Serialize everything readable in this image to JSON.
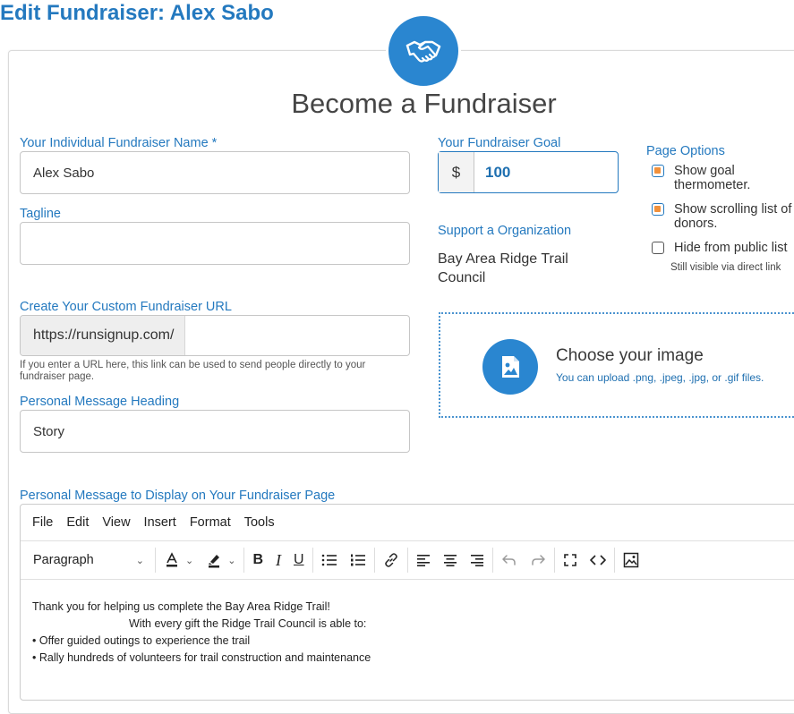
{
  "page": {
    "title": "Edit Fundraiser: Alex Sabo",
    "badge_icon": "handshake-icon"
  },
  "form": {
    "heading": "Become a Fundraiser",
    "name": {
      "label": "Your Individual Fundraiser Name *",
      "value": "Alex Sabo"
    },
    "tagline": {
      "label": "Tagline",
      "value": ""
    },
    "url": {
      "label": "Create Your Custom Fundraiser URL",
      "prefix": "https://runsignup.com/",
      "value": "",
      "help": "If you enter a URL here, this link can be used to send people directly to your fundraiser page."
    },
    "message_heading": {
      "label": "Personal Message Heading",
      "value": "Story"
    },
    "goal": {
      "label": "Your Fundraiser Goal",
      "currency": "$",
      "value": "100"
    },
    "organization": {
      "label": "Support a Organization",
      "name": "Bay Area Ridge Trail Council"
    },
    "page_options": {
      "label": "Page Options",
      "options": [
        {
          "text": "Show goal thermometer.",
          "checked": true
        },
        {
          "text": "Show scrolling list of donors.",
          "checked": true
        },
        {
          "text": "Hide from public list",
          "checked": false
        }
      ],
      "note": "Still visible via direct link"
    },
    "image_upload": {
      "title": "Choose your image",
      "subtitle": "You can upload .png, .jpeg, .jpg, or .gif files.",
      "icon": "image-icon"
    },
    "message": {
      "label": "Personal Message to Display on Your Fundraiser Page",
      "menu": [
        "File",
        "Edit",
        "View",
        "Insert",
        "Format",
        "Tools"
      ],
      "block_format": "Paragraph",
      "lines": [
        "Thank you for helping us complete the Bay Area Ridge Trail!",
        "With every gift the Ridge Trail Council is able to:",
        "• Offer guided outings to experience the trail",
        "• Rally hundreds of volunteers for trail construction and maintenance"
      ]
    }
  },
  "colors": {
    "accent": "#2479bf",
    "badge": "#2a86d0",
    "checkbox_fill": "#f1913c"
  }
}
